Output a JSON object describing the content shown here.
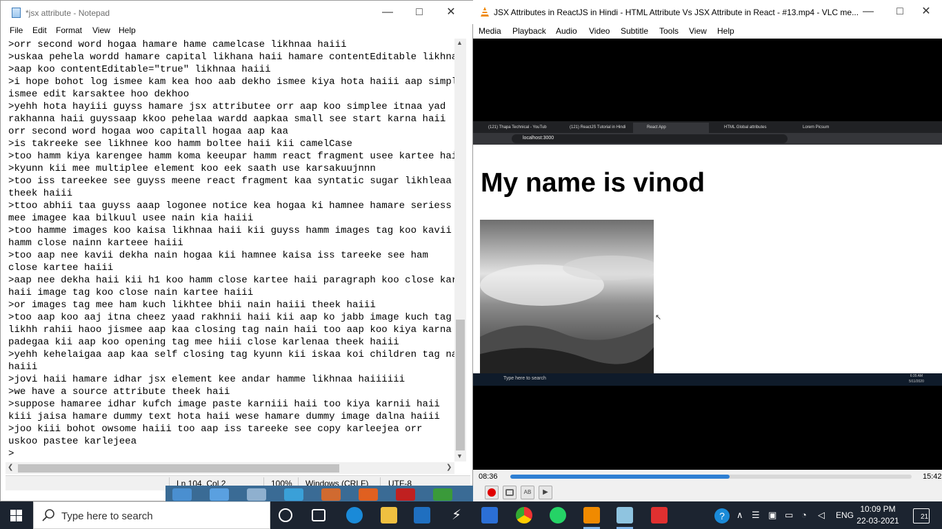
{
  "notepad": {
    "title": "*jsx attribute - Notepad",
    "menu": [
      "File",
      "Edit",
      "Format",
      "View",
      "Help"
    ],
    "lines": [
      ">orr second word hogaa hamare hame camelcase likhnaa haiii",
      ">uskaa pehela wordd hamare capital likhana haii hamare contentEditable likhnaa ha",
      ">aap koo contentEditable=\"true\" likhnaa haiii",
      ">i hope bohot log ismee kam kea hoo aab dekho ismee kiya hota haiii aap simply",
      "ismee edit karsaktee hoo dekhoo",
      ">yehh hota hayiii guyss hamare jsx attributee orr aap koo simplee itnaa yad",
      "rakhanna haii guyssaap kkoo pehelaa wardd aapkaa small see start karna haii",
      "orr second word hogaa woo capitall hogaa aap kaa",
      ">is takreeke see likhnee koo hamm boltee haii kii camelCase",
      ">too hamm kiya karengee hamm koma keeupar hamm react fragment usee kartee hai",
      ">kyunn kii mee multiplee element koo eek saath use karsakuujnnn",
      ">too iss tareekee see guyss meene react fragment kaa syntatic sugar likhleaa",
      "theek haiii",
      ">ttoo abhii taa guyss aaap logonee notice kea hogaa ki hamnee hamare seriess",
      "mee imagee kaa bilkuul usee nain kia haiii",
      ">too hamme images koo kaisa likhnaa haii kii guyss hamm images tag koo kavii",
      "hamm close nainn karteee haiii",
      ">too aap nee kavii dekha nain hogaa kii hamnee kaisa iss tareeke see ham",
      "close kartee haiii",
      ">aap nee dekha haii kii h1 koo hamm close kartee haii paragraph koo close kartee",
      "haii image tag koo close nain kartee haiii",
      ">or images tag mee ham kuch likhtee bhii nain haiii theek haiii",
      ">too aap koo aaj itna cheez yaad rakhnii haii kii aap ko jabb image kuch tag",
      "likhh rahii haoo jismee aap kaa closing tag nain haii too aap koo kiya karna",
      "padegaa kii aap koo opening tag mee hiii close karlenaa theek haiii",
      ">yehh kehelaigaa aap kaa self closing tag kyunn kii iskaa koi children tag nain",
      "haiii",
      ">jovi haii hamare idhar jsx element kee andar hamme likhnaa haiiiiii",
      ">we have a source attribute theek haii",
      ">suppose hamaree idhar kufch image paste karniii haii too kiya karnii haii",
      "kiii jaisa hamare dummy text hota haii wese hamare dummy image dalna haiii",
      ">joo kiii bohot owsome haiii too aap iss tareeke see copy karleejea orr",
      "uskoo pastee karlejeea",
      ">"
    ],
    "status": {
      "position": "Ln 104, Col 2",
      "zoom": "100%",
      "line_ending": "Windows (CRLF)",
      "encoding": "UTF-8"
    }
  },
  "vlc": {
    "title": "JSX Attributes in ReactJS in Hindi - HTML Attribute Vs JSX Attribute in React  - #13.mp4 - VLC me...",
    "menu": [
      "Media",
      "Playback",
      "Audio",
      "Video",
      "Subtitle",
      "Tools",
      "View",
      "Help"
    ],
    "elapsed": "08:36",
    "total": "15:42",
    "progress": 0.547,
    "browser": {
      "tabs": [
        "(121) Thapa Technical - YouTub",
        "(121) ReactJS Tutorial in Hindi",
        "React App",
        "HTML Global attributes",
        "Lorem Picsum"
      ],
      "url": "localhost:3000",
      "heading": "My name is vinod",
      "taskbar_search": "Type here to search",
      "clock_time": "6:35 AM",
      "clock_date": "5/11/2020"
    }
  },
  "taskbar": {
    "search_placeholder": "Type here to search",
    "lang": "ENG",
    "time": "10:09 PM",
    "date": "22-03-2021",
    "notification_count": "21"
  },
  "colors": {
    "accent_blue": "#2e7fd3",
    "taskbar": "#1c2430",
    "vlc_orange": "#f08a00"
  }
}
